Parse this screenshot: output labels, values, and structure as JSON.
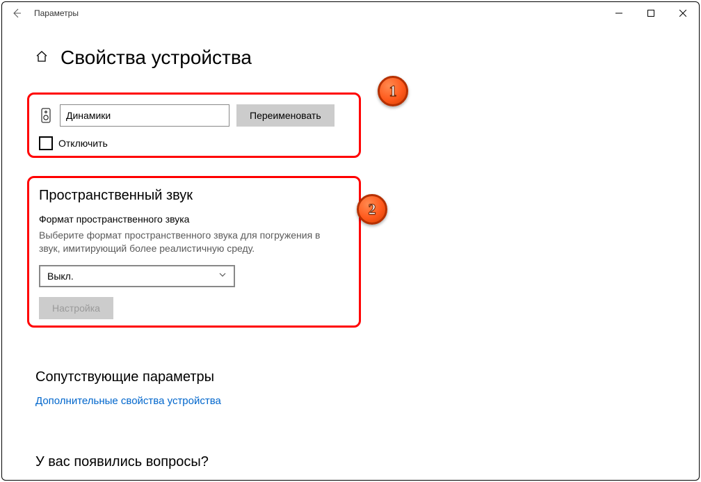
{
  "titlebar": {
    "title": "Параметры"
  },
  "page": {
    "title": "Свойства устройства"
  },
  "callouts": {
    "one": "1",
    "two": "2"
  },
  "device": {
    "name_value": "Динамики",
    "rename_label": "Переименовать",
    "disable_label": "Отключить"
  },
  "spatial": {
    "heading": "Пространственный звук",
    "format_label": "Формат пространственного звука",
    "description": "Выберите формат пространственного звука для погружения в звук, имитирующий более реалистичную среду.",
    "selected": "Выкл.",
    "configure_label": "Настройка"
  },
  "related": {
    "heading": "Сопутствующие параметры",
    "link": "Дополнительные свойства устройства"
  },
  "help": {
    "heading": "У вас появились вопросы?"
  }
}
